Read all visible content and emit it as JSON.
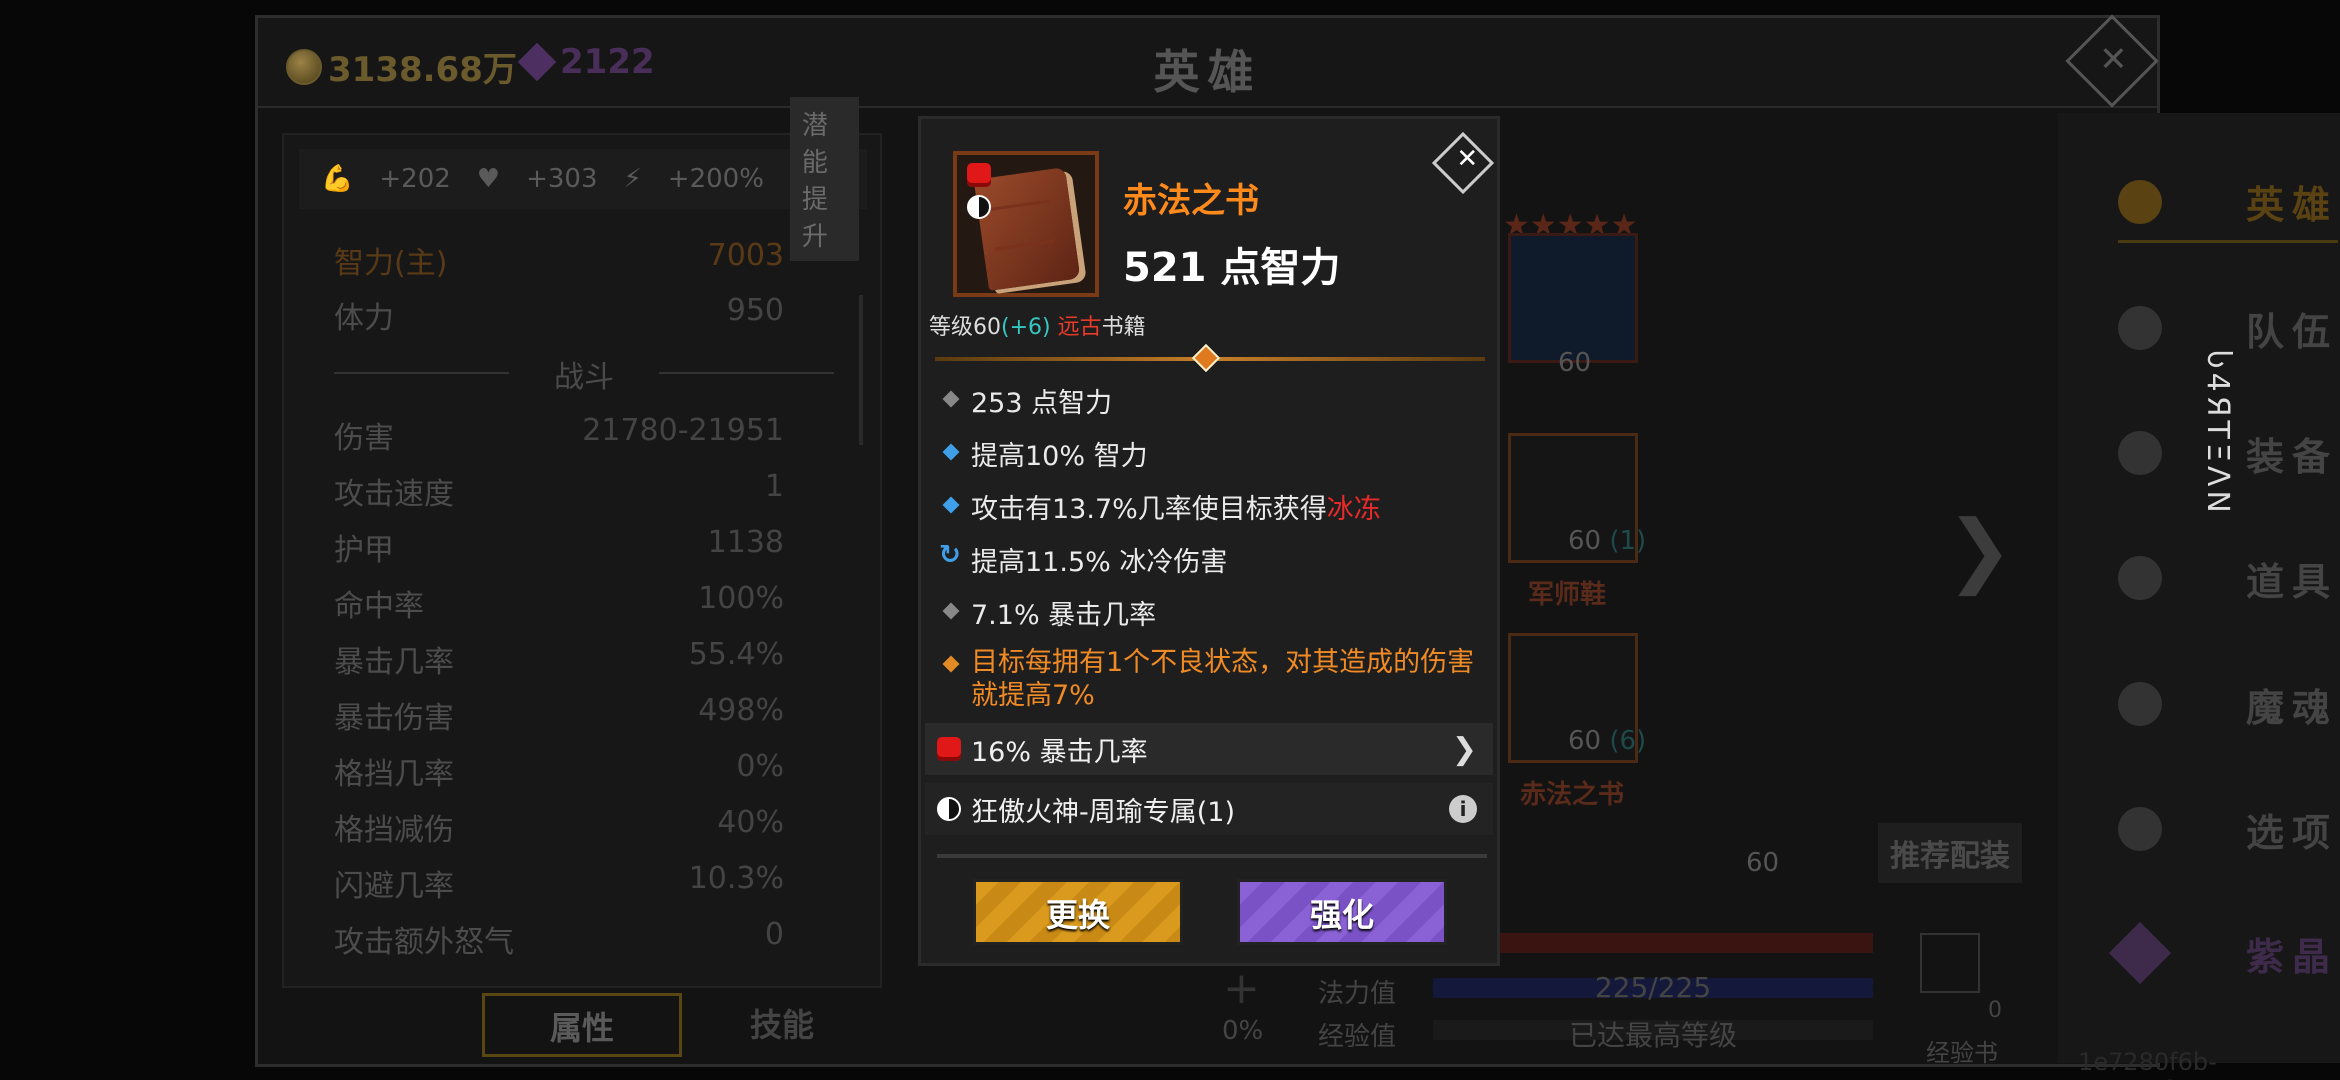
{
  "currency": {
    "gold": "3138.68万",
    "gems": "2122"
  },
  "header": {
    "title": "英雄"
  },
  "stats_panel": {
    "bonus": {
      "strength": "+202",
      "health": "+303",
      "energy": "+200%",
      "potential_button": "潜能提升"
    },
    "top_rows": [
      {
        "label": "智力(主)",
        "value": "7003"
      },
      {
        "label": "体力",
        "value": "950"
      }
    ],
    "combat_title": "战斗",
    "combat_rows": [
      {
        "label": "伤害",
        "value": "21780-21951"
      },
      {
        "label": "攻击速度",
        "value": "1"
      },
      {
        "label": "护甲",
        "value": "1138"
      },
      {
        "label": "命中率",
        "value": "100%"
      },
      {
        "label": "暴击几率",
        "value": "55.4%"
      },
      {
        "label": "暴击伤害",
        "value": "498%"
      },
      {
        "label": "格挡几率",
        "value": "0%"
      },
      {
        "label": "格挡减伤",
        "value": "40%"
      },
      {
        "label": "闪避几率",
        "value": "10.3%"
      },
      {
        "label": "攻击额外怒气",
        "value": "0"
      }
    ],
    "tabs": [
      "属性",
      "技能"
    ]
  },
  "hero_area": {
    "stars": "★★★★★",
    "pet_level": "60",
    "shoes": {
      "level": "60",
      "bonus": "(1)",
      "name": "军师鞋"
    },
    "book": {
      "level": "60",
      "bonus": "(6)",
      "name": "赤法之书"
    },
    "recommend": "推荐配装",
    "partial_level": "60",
    "mana_label": "法力值",
    "mana_value": "225/225",
    "exp_label": "经验值",
    "exp_value": "已达最高等级",
    "exp_book_label": "经验书",
    "exp_book_count": "0",
    "percent": "0%"
  },
  "menu": [
    {
      "label": "英雄",
      "icon": "people-icon"
    },
    {
      "label": "队伍",
      "icon": "flag-icon"
    },
    {
      "label": "装备",
      "icon": "helmet-icon"
    },
    {
      "label": "道具",
      "icon": "bag-icon"
    },
    {
      "label": "魔魂",
      "icon": "fire-icon"
    },
    {
      "label": "选项",
      "icon": "gear-icon"
    },
    {
      "label": "紫晶",
      "icon": "amethyst-icon"
    }
  ],
  "uuid": "1e7280f6b-2e43-4f0e-8b19",
  "side_text": "Ⴑ4ЯΤΞΛΝ",
  "popup": {
    "name": "赤法之书",
    "main_stat": "521 点智力",
    "level_prefix": "等级60",
    "level_bonus": "(+6)",
    "rarity": "远古",
    "type": "书籍",
    "affixes": [
      {
        "text": "253 点智力"
      },
      {
        "text": "提高10% 智力"
      },
      {
        "text": "攻击有13.7%几率使目标获得",
        "highlight": "冰冻"
      },
      {
        "text": "提高11.5% 冰冷伤害"
      },
      {
        "text": "7.1% 暴击几率"
      },
      {
        "text": "目标每拥有1个不良状态，对其造成的伤害就提高7%"
      }
    ],
    "socket_text": "16% 暴击几率",
    "set_text": "狂傲火神-周瑜专属(1)",
    "replace_button": "更换",
    "enhance_button": "强化"
  },
  "colors": {
    "legendary_orange": "#ff8a1c",
    "cyan_bonus": "#36c7c2",
    "ancient_red": "#e83a2a",
    "replace_gold": "#d99a1e",
    "enhance_purple": "#8a62d6"
  }
}
